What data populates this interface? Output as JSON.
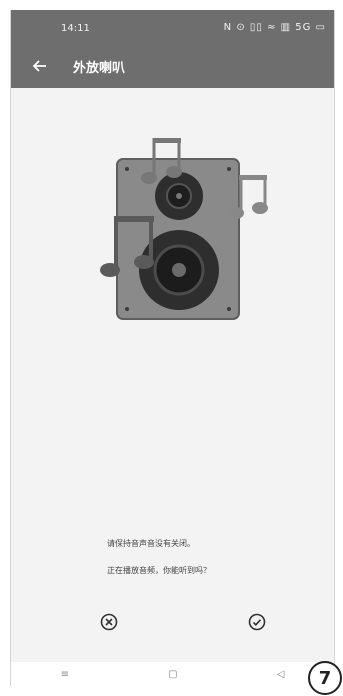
{
  "status_bar": {
    "time": "14:11",
    "icons_text": "N ⊙ ▯▯ ≈ ▥ 5G ▭"
  },
  "app_bar": {
    "title": "外放喇叭",
    "back_icon": "arrow-left-icon"
  },
  "messages": {
    "line1": "请保持音声音没有关闭。",
    "line2": "正在播放音频，你能听到吗？"
  },
  "actions": {
    "cancel_icon": "circle-x-icon",
    "confirm_icon": "circle-check-icon"
  },
  "nav": {
    "menu": "≡",
    "home": "▢",
    "back": "◁"
  },
  "figure_label": "7"
}
